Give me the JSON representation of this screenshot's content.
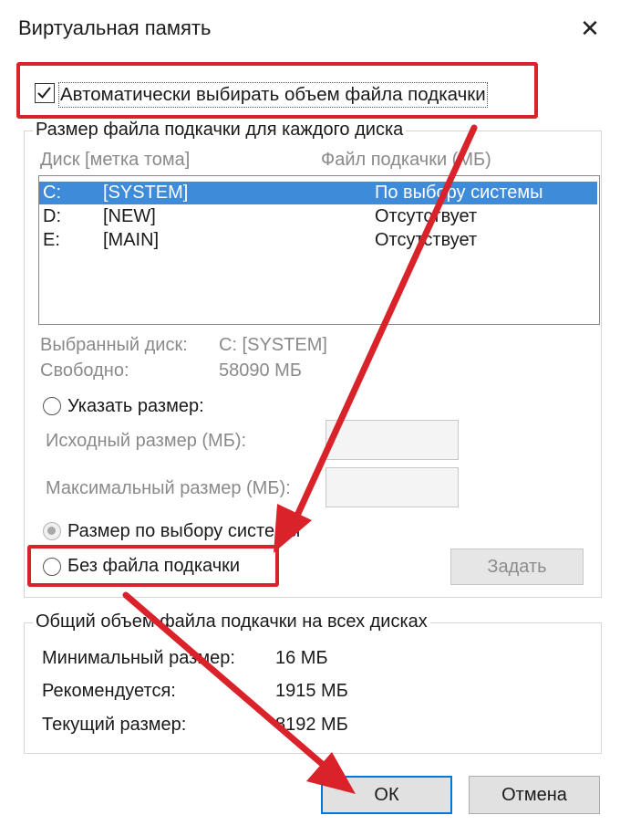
{
  "window": {
    "title": "Виртуальная память",
    "close_glyph": "✕"
  },
  "auto_manage": {
    "label": "Автоматически выбирать объем файла подкачки",
    "checked": true
  },
  "per_drive": {
    "legend": "Размер файла подкачки для каждого диска",
    "col_drive": "Диск [метка тома]",
    "col_pagefile": "Файл подкачки (МБ)",
    "drives": [
      {
        "letter": "C:",
        "label": "[SYSTEM]",
        "pagefile": "По выбору системы",
        "selected": true
      },
      {
        "letter": "D:",
        "label": "[NEW]",
        "pagefile": "Отсутствует",
        "selected": false
      },
      {
        "letter": "E:",
        "label": "[MAIN]",
        "pagefile": "Отсутствует",
        "selected": false
      }
    ],
    "selected_drive_label": "Выбранный диск:",
    "selected_drive_value": "C:  [SYSTEM]",
    "free_label": "Свободно:",
    "free_value": "58090 МБ",
    "custom_size_label": "Указать размер:",
    "initial_size_label": "Исходный размер (МБ):",
    "max_size_label": "Максимальный размер (МБ):",
    "system_managed_label": "Размер по выбору системы",
    "no_pagefile_label": "Без файла подкачки",
    "set_button": "Задать"
  },
  "totals": {
    "legend": "Общий объем файла подкачки на всех дисках",
    "min_label": "Минимальный размер:",
    "min_value": "16 МБ",
    "recommended_label": "Рекомендуется:",
    "recommended_value": "1915 МБ",
    "current_label": "Текущий размер:",
    "current_value": "8192 МБ"
  },
  "buttons": {
    "ok": "ОК",
    "cancel": "Отмена"
  },
  "colors": {
    "highlight": "#d9222a",
    "selection": "#3d8bd9",
    "focus": "#0078d7"
  },
  "icons": {
    "checkbox": "check-icon",
    "close": "close-icon"
  }
}
